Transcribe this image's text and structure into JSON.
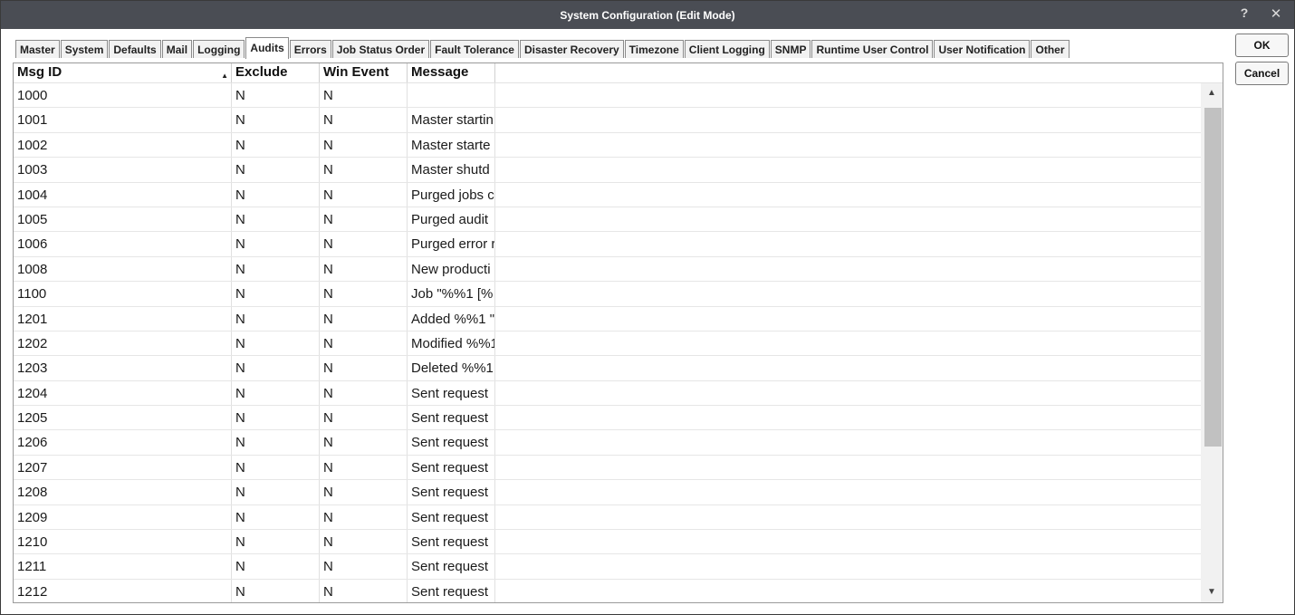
{
  "window": {
    "title": "System Configuration (Edit Mode)",
    "help_glyph": "?",
    "close_glyph": "✕"
  },
  "tabs": [
    {
      "label": "Master"
    },
    {
      "label": "System"
    },
    {
      "label": "Defaults"
    },
    {
      "label": "Mail"
    },
    {
      "label": "Logging"
    },
    {
      "label": "Audits",
      "active": true
    },
    {
      "label": "Errors"
    },
    {
      "label": "Job Status Order"
    },
    {
      "label": "Fault Tolerance"
    },
    {
      "label": "Disaster Recovery"
    },
    {
      "label": "Timezone"
    },
    {
      "label": "Client Logging"
    },
    {
      "label": "SNMP"
    },
    {
      "label": "Runtime User Control"
    },
    {
      "label": "User Notification"
    },
    {
      "label": "Other"
    }
  ],
  "buttons": {
    "ok": "OK",
    "cancel": "Cancel"
  },
  "grid": {
    "columns": [
      "Msg ID",
      "Exclude",
      "Win Event",
      "Message"
    ],
    "sorted_column": "Msg ID",
    "sort_direction": "ascending",
    "rows": [
      [
        "1000",
        "N",
        "N",
        ""
      ],
      [
        "1001",
        "N",
        "N",
        "Master startin"
      ],
      [
        "1002",
        "N",
        "N",
        "Master starte"
      ],
      [
        "1003",
        "N",
        "N",
        "Master shutd"
      ],
      [
        "1004",
        "N",
        "N",
        "Purged jobs c"
      ],
      [
        "1005",
        "N",
        "N",
        "Purged audit"
      ],
      [
        "1006",
        "N",
        "N",
        "Purged error r"
      ],
      [
        "1008",
        "N",
        "N",
        "New producti"
      ],
      [
        "1100",
        "N",
        "N",
        "Job \"%%1 [%"
      ],
      [
        "1201",
        "N",
        "N",
        "Added %%1 \""
      ],
      [
        "1202",
        "N",
        "N",
        "Modified %%1"
      ],
      [
        "1203",
        "N",
        "N",
        "Deleted %%1"
      ],
      [
        "1204",
        "N",
        "N",
        "Sent request"
      ],
      [
        "1205",
        "N",
        "N",
        "Sent request"
      ],
      [
        "1206",
        "N",
        "N",
        "Sent request"
      ],
      [
        "1207",
        "N",
        "N",
        "Sent request"
      ],
      [
        "1208",
        "N",
        "N",
        "Sent request"
      ],
      [
        "1209",
        "N",
        "N",
        "Sent request"
      ],
      [
        "1210",
        "N",
        "N",
        "Sent request"
      ],
      [
        "1211",
        "N",
        "N",
        "Sent request"
      ],
      [
        "1212",
        "N",
        "N",
        "Sent request"
      ]
    ]
  },
  "scrollbar": {
    "up_glyph": "▲",
    "down_glyph": "▼"
  },
  "colors": {
    "titlebar": "#4a4d54",
    "scroll_thumb": "#c1c1c1"
  }
}
